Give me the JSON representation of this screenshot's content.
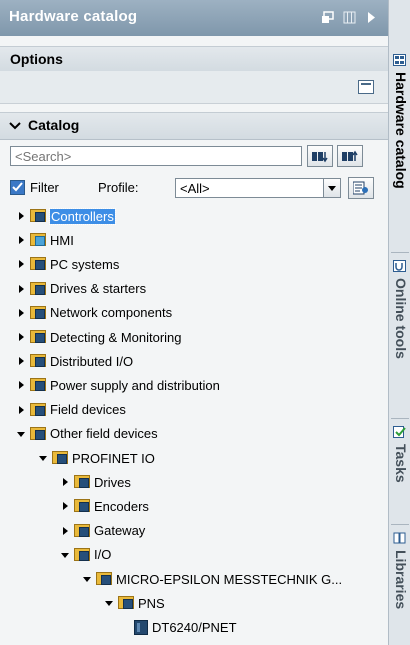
{
  "panel": {
    "title": "Hardware catalog"
  },
  "options": {
    "label": "Options"
  },
  "catalog": {
    "label": "Catalog"
  },
  "search": {
    "placeholder": "<Search>"
  },
  "filter": {
    "label": "Filter",
    "checked": true,
    "profile_label": "Profile:",
    "profile_value": "<All>"
  },
  "tree": [
    {
      "label": "Controllers",
      "state": "collapsed",
      "icon": "folder-device-icon",
      "selected": true
    },
    {
      "label": "HMI",
      "state": "collapsed",
      "icon": "folder-hmi-icon"
    },
    {
      "label": "PC systems",
      "state": "collapsed",
      "icon": "folder-device-icon"
    },
    {
      "label": "Drives & starters",
      "state": "collapsed",
      "icon": "folder-device-icon"
    },
    {
      "label": "Network components",
      "state": "collapsed",
      "icon": "folder-device-icon"
    },
    {
      "label": "Detecting & Monitoring",
      "state": "collapsed",
      "icon": "folder-device-icon"
    },
    {
      "label": "Distributed I/O",
      "state": "collapsed",
      "icon": "folder-device-icon"
    },
    {
      "label": "Power supply and distribution",
      "state": "collapsed",
      "icon": "folder-device-icon"
    },
    {
      "label": "Field devices",
      "state": "collapsed",
      "icon": "folder-device-icon"
    },
    {
      "label": "Other field devices",
      "state": "expanded",
      "icon": "folder-device-icon"
    },
    {
      "label": "PROFINET IO",
      "state": "expanded",
      "icon": "folder-device-icon"
    },
    {
      "label": "Drives",
      "state": "collapsed",
      "icon": "folder-device-icon"
    },
    {
      "label": "Encoders",
      "state": "collapsed",
      "icon": "folder-device-icon"
    },
    {
      "label": "Gateway",
      "state": "collapsed",
      "icon": "folder-device-icon"
    },
    {
      "label": "I/O",
      "state": "expanded",
      "icon": "folder-device-icon"
    },
    {
      "label": "MICRO-EPSILON MESSTECHNIK G...",
      "state": "expanded",
      "icon": "folder-device-icon"
    },
    {
      "label": "PNS",
      "state": "expanded",
      "icon": "folder-device-icon"
    },
    {
      "label": "DT6240/PNET",
      "state": "leaf",
      "icon": "device-icon"
    }
  ],
  "sidebar": {
    "tabs": [
      {
        "label": "Hardware catalog",
        "icon": "catalog-icon",
        "active": true
      },
      {
        "label": "Online tools",
        "icon": "online-tools-icon",
        "active": false
      },
      {
        "label": "Tasks",
        "icon": "tasks-icon",
        "active": false
      },
      {
        "label": "Libraries",
        "icon": "libraries-icon",
        "active": false
      }
    ]
  },
  "colors": {
    "titlebar": "#8da4b8",
    "selection": "#3d8ee6",
    "folder": "#e9b93a",
    "device": "#264f7a"
  }
}
